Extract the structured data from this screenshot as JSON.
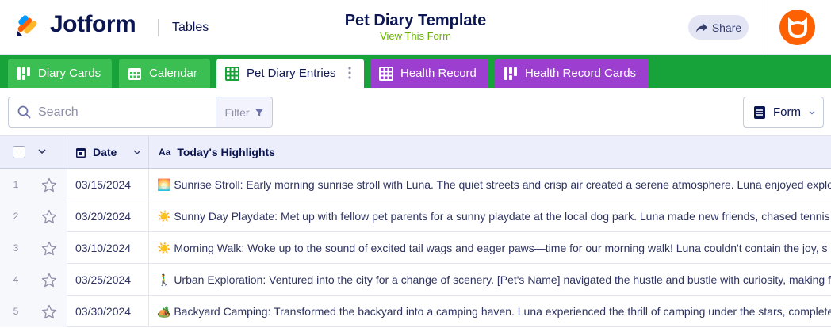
{
  "header": {
    "brand": "Jotform",
    "product": "Tables",
    "form_title": "Pet Diary Template",
    "view_form_link": "View This Form",
    "share_label": "Share",
    "colors": {
      "brand_green": "#64b200",
      "avatar": "#ff6100"
    }
  },
  "tabs": [
    {
      "label": "Diary Cards",
      "icon": "cards-icon",
      "style": "green"
    },
    {
      "label": "Calendar",
      "icon": "calendar-icon",
      "style": "green"
    },
    {
      "label": "Pet Diary Entries",
      "icon": "table-icon",
      "style": "active"
    },
    {
      "label": "Health Record",
      "icon": "table-icon",
      "style": "purple"
    },
    {
      "label": "Health Record Cards",
      "icon": "cards-icon",
      "style": "purple"
    }
  ],
  "toolbar": {
    "search_placeholder": "Search",
    "filter_label": "Filter",
    "view_label": "Form"
  },
  "table": {
    "columns": [
      {
        "label": "Date",
        "icon": "calendar-icon"
      },
      {
        "label": "Today's Highlights",
        "icon": "text-type-icon",
        "icon_text": "Aa"
      }
    ],
    "rows": [
      {
        "num": "1",
        "date": "03/15/2024",
        "highlight": "🌅 Sunrise Stroll: Early morning sunrise stroll with Luna. The quiet streets and crisp air created a serene atmosphere. Luna enjoyed exploring"
      },
      {
        "num": "2",
        "date": "03/20/2024",
        "highlight": "☀️ Sunny Day Playdate: Met up with fellow pet parents for a sunny playdate at the local dog park. Luna made new friends, chased tennis ba"
      },
      {
        "num": "3",
        "date": "03/10/2024",
        "highlight": "☀️ Morning Walk: Woke up to the sound of excited tail wags and eager paws—time for our morning walk! Luna couldn't contain the joy, s"
      },
      {
        "num": "4",
        "date": "03/25/2024",
        "highlight": "🚶‍♂️ Urban Exploration: Ventured into the city for a change of scenery. [Pet's Name] navigated the hustle and bustle with curiosity, making f"
      },
      {
        "num": "5",
        "date": "03/30/2024",
        "highlight": "🏕️ Backyard Camping: Transformed the backyard into a camping haven. Luna experienced the thrill of camping under the stars, complete w"
      }
    ]
  }
}
